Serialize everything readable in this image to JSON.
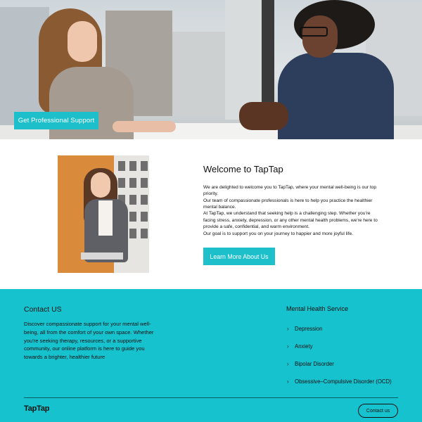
{
  "hero": {
    "cta_label": "Get  Professional Support"
  },
  "welcome": {
    "title": "Welcome to TapTap",
    "paragraphs": [
      "We are delighted to welcome you to TapTap, where your mental well-being is our top priority.",
      "Our team of compassionate professionals is here to help you practice the healthier mental balance.",
      "At TapTap, we understand that seeking help is a challenging step. Whether you're facing stress, anxiety, depression, or any other mental health problems, we're here to provide a safe, confidential, and warm environment.",
      "Our goal is to support you on your journey to happier and more joyful life."
    ],
    "cta_label": "Learn More About Us"
  },
  "footer": {
    "contact_title": "Contact US",
    "contact_text": "Discover compassionate support for your mental well-being, all from the comfort of your own space. Whether you're seeking therapy, resources, or a supportive community, our online platform is here to guide you towards a brighter, healthier future",
    "services_title": "Mental Health Service",
    "services": [
      {
        "label": "Depression"
      },
      {
        "label": "Anxiety"
      },
      {
        "label": "Bipolar Disorder"
      },
      {
        "label": "Obsessive–Compulsive Disorder (OCD)"
      }
    ],
    "logo": "TapTap",
    "contact_button": "Contact us"
  },
  "colors": {
    "accent": "#1dbfcb",
    "footer_bg": "#16c2ce",
    "text": "#111111"
  },
  "icons": {
    "service_bullet": "chevron-right-icon"
  }
}
